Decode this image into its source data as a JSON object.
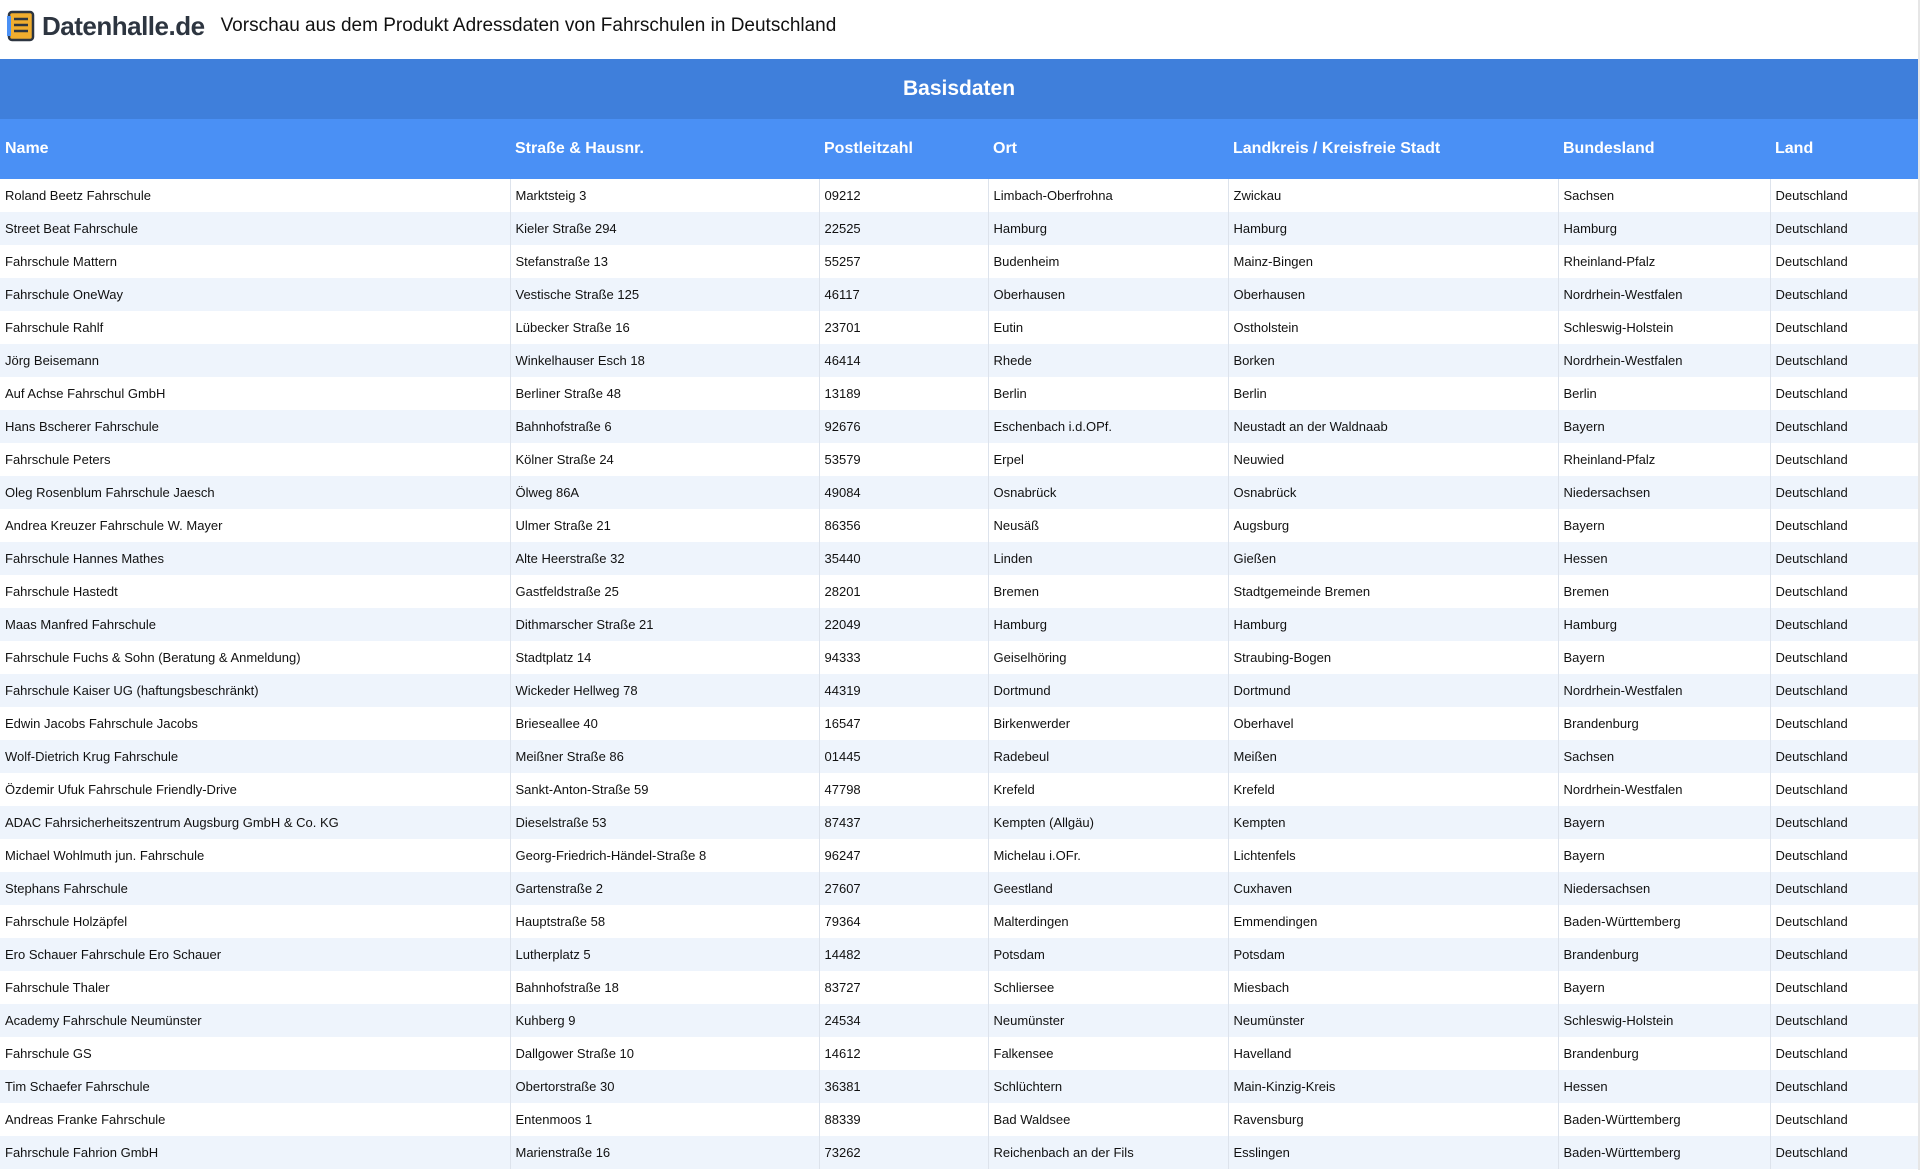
{
  "header": {
    "logo_text": "Datenhalle.de",
    "title": "Vorschau aus dem Produkt Adressdaten von Fahrschulen in Deutschland"
  },
  "colors": {
    "group_header_bg": "#3f7fdb",
    "column_header_bg": "#4a90f5",
    "row_alt_bg": "#eef4fc"
  },
  "table": {
    "group_label": "Basisdaten",
    "columns": [
      "Name",
      "Straße & Hausnr.",
      "Postleitzahl",
      "Ort",
      "Landkreis / Kreisfreie Stadt",
      "Bundesland",
      "Land"
    ],
    "rows": [
      [
        "Roland Beetz Fahrschule",
        "Marktsteig 3",
        "09212",
        "Limbach-Oberfrohna",
        "Zwickau",
        "Sachsen",
        "Deutschland"
      ],
      [
        "Street Beat Fahrschule",
        "Kieler Straße 294",
        "22525",
        "Hamburg",
        "Hamburg",
        "Hamburg",
        "Deutschland"
      ],
      [
        "Fahrschule Mattern",
        "Stefanstraße 13",
        "55257",
        "Budenheim",
        "Mainz-Bingen",
        "Rheinland-Pfalz",
        "Deutschland"
      ],
      [
        "Fahrschule OneWay",
        "Vestische Straße 125",
        "46117",
        "Oberhausen",
        "Oberhausen",
        "Nordrhein-Westfalen",
        "Deutschland"
      ],
      [
        "Fahrschule Rahlf",
        "Lübecker Straße 16",
        "23701",
        "Eutin",
        "Ostholstein",
        "Schleswig-Holstein",
        "Deutschland"
      ],
      [
        "Jörg Beisemann",
        "Winkelhauser Esch 18",
        "46414",
        "Rhede",
        "Borken",
        "Nordrhein-Westfalen",
        "Deutschland"
      ],
      [
        "Auf Achse Fahrschul GmbH",
        "Berliner Straße 48",
        "13189",
        "Berlin",
        "Berlin",
        "Berlin",
        "Deutschland"
      ],
      [
        "Hans Bscherer Fahrschule",
        "Bahnhofstraße 6",
        "92676",
        "Eschenbach i.d.OPf.",
        "Neustadt an der Waldnaab",
        "Bayern",
        "Deutschland"
      ],
      [
        "Fahrschule Peters",
        "Kölner Straße 24",
        "53579",
        "Erpel",
        "Neuwied",
        "Rheinland-Pfalz",
        "Deutschland"
      ],
      [
        "Oleg Rosenblum Fahrschule Jaesch",
        "Ölweg 86A",
        "49084",
        "Osnabrück",
        "Osnabrück",
        "Niedersachsen",
        "Deutschland"
      ],
      [
        "Andrea Kreuzer Fahrschule W. Mayer",
        "Ulmer Straße 21",
        "86356",
        "Neusäß",
        "Augsburg",
        "Bayern",
        "Deutschland"
      ],
      [
        "Fahrschule Hannes Mathes",
        "Alte Heerstraße 32",
        "35440",
        "Linden",
        "Gießen",
        "Hessen",
        "Deutschland"
      ],
      [
        "Fahrschule Hastedt",
        "Gastfeldstraße 25",
        "28201",
        "Bremen",
        "Stadtgemeinde Bremen",
        "Bremen",
        "Deutschland"
      ],
      [
        "Maas Manfred Fahrschule",
        "Dithmarscher Straße 21",
        "22049",
        "Hamburg",
        "Hamburg",
        "Hamburg",
        "Deutschland"
      ],
      [
        "Fahrschule Fuchs & Sohn (Beratung & Anmeldung)",
        "Stadtplatz 14",
        "94333",
        "Geiselhöring",
        "Straubing-Bogen",
        "Bayern",
        "Deutschland"
      ],
      [
        "Fahrschule Kaiser UG (haftungsbeschränkt)",
        "Wickeder Hellweg 78",
        "44319",
        "Dortmund",
        "Dortmund",
        "Nordrhein-Westfalen",
        "Deutschland"
      ],
      [
        "Edwin Jacobs Fahrschule Jacobs",
        "Brieseallee 40",
        "16547",
        "Birkenwerder",
        "Oberhavel",
        "Brandenburg",
        "Deutschland"
      ],
      [
        "Wolf-Dietrich Krug Fahrschule",
        "Meißner Straße 86",
        "01445",
        "Radebeul",
        "Meißen",
        "Sachsen",
        "Deutschland"
      ],
      [
        "Özdemir Ufuk Fahrschule Friendly-Drive",
        "Sankt-Anton-Straße 59",
        "47798",
        "Krefeld",
        "Krefeld",
        "Nordrhein-Westfalen",
        "Deutschland"
      ],
      [
        "ADAC Fahrsicherheitszentrum Augsburg GmbH & Co. KG",
        "Dieselstraße 53",
        "87437",
        "Kempten (Allgäu)",
        "Kempten",
        "Bayern",
        "Deutschland"
      ],
      [
        "Michael Wohlmuth jun. Fahrschule",
        "Georg-Friedrich-Händel-Straße 8",
        "96247",
        "Michelau i.OFr.",
        "Lichtenfels",
        "Bayern",
        "Deutschland"
      ],
      [
        "Stephans Fahrschule",
        "Gartenstraße 2",
        "27607",
        "Geestland",
        "Cuxhaven",
        "Niedersachsen",
        "Deutschland"
      ],
      [
        "Fahrschule Holzäpfel",
        "Hauptstraße 58",
        "79364",
        "Malterdingen",
        "Emmendingen",
        "Baden-Württemberg",
        "Deutschland"
      ],
      [
        "Ero Schauer Fahrschule Ero Schauer",
        "Lutherplatz 5",
        "14482",
        "Potsdam",
        "Potsdam",
        "Brandenburg",
        "Deutschland"
      ],
      [
        "Fahrschule Thaler",
        "Bahnhofstraße 18",
        "83727",
        "Schliersee",
        "Miesbach",
        "Bayern",
        "Deutschland"
      ],
      [
        "Academy Fahrschule Neumünster",
        "Kuhberg 9",
        "24534",
        "Neumünster",
        "Neumünster",
        "Schleswig-Holstein",
        "Deutschland"
      ],
      [
        "Fahrschule GS",
        "Dallgower Straße 10",
        "14612",
        "Falkensee",
        "Havelland",
        "Brandenburg",
        "Deutschland"
      ],
      [
        "Tim Schaefer Fahrschule",
        "Obertorstraße 30",
        "36381",
        "Schlüchtern",
        "Main-Kinzig-Kreis",
        "Hessen",
        "Deutschland"
      ],
      [
        "Andreas Franke Fahrschule",
        "Entenmoos 1",
        "88339",
        "Bad Waldsee",
        "Ravensburg",
        "Baden-Württemberg",
        "Deutschland"
      ],
      [
        "Fahrschule Fahrion GmbH",
        "Marienstraße 16",
        "73262",
        "Reichenbach an der Fils",
        "Esslingen",
        "Baden-Württemberg",
        "Deutschland"
      ]
    ]
  }
}
